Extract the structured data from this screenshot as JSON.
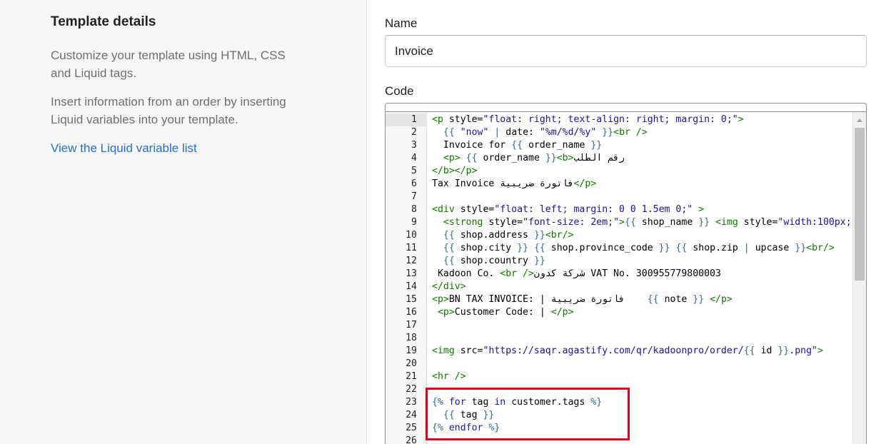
{
  "sidebar": {
    "title": "Template details",
    "description1": "Customize your template using HTML, CSS and Liquid tags.",
    "description2": "Insert information from an order by inserting Liquid variables into your template.",
    "link": "View the Liquid variable list"
  },
  "form": {
    "name_label": "Name",
    "name_value": "Invoice",
    "code_label": "Code"
  },
  "editor": {
    "lines": [
      {
        "n": "1",
        "segs": [
          [
            "t",
            "<p "
          ],
          [
            "a",
            "style="
          ],
          [
            "s",
            "\"float: right; text-align: right; margin: 0;\""
          ],
          [
            "t",
            ">"
          ]
        ]
      },
      {
        "n": "2",
        "segs": [
          [
            "p",
            "  "
          ],
          [
            "lq",
            "{{ "
          ],
          [
            "s",
            "\"now\""
          ],
          [
            "lq",
            " | "
          ],
          [
            "p",
            "date: "
          ],
          [
            "s",
            "\"%m/%d/%y\""
          ],
          [
            "lq",
            " }}"
          ],
          [
            "t",
            "<br />"
          ]
        ]
      },
      {
        "n": "3",
        "segs": [
          [
            "p",
            "  Invoice for "
          ],
          [
            "lq",
            "{{ "
          ],
          [
            "p",
            "order_name"
          ],
          [
            "lq",
            " }}"
          ]
        ]
      },
      {
        "n": "4",
        "segs": [
          [
            "p",
            "  "
          ],
          [
            "t",
            "<p>"
          ],
          [
            "p",
            " "
          ],
          [
            "lq",
            "{{ "
          ],
          [
            "p",
            "order_name"
          ],
          [
            "lq",
            " }}"
          ],
          [
            "t",
            "<b>"
          ],
          [
            "p",
            "رقم الطلب"
          ]
        ]
      },
      {
        "n": "5",
        "segs": [
          [
            "t",
            "</b></p>"
          ]
        ]
      },
      {
        "n": "6",
        "segs": [
          [
            "p",
            "Tax Invoice فاتورة ضريبية"
          ],
          [
            "t",
            "</p>"
          ]
        ]
      },
      {
        "n": "7",
        "segs": []
      },
      {
        "n": "8",
        "segs": [
          [
            "t",
            "<div "
          ],
          [
            "a",
            "style="
          ],
          [
            "s",
            "\"float: left; margin: 0 0 1.5em 0;\""
          ],
          [
            "p",
            " "
          ],
          [
            "t",
            ">"
          ]
        ]
      },
      {
        "n": "9",
        "segs": [
          [
            "p",
            "  "
          ],
          [
            "t",
            "<strong "
          ],
          [
            "a",
            "style="
          ],
          [
            "s",
            "\"font-size: 2em;\""
          ],
          [
            "t",
            ">"
          ],
          [
            "lq",
            "{{ "
          ],
          [
            "p",
            "shop_name"
          ],
          [
            "lq",
            " }}"
          ],
          [
            "p",
            " "
          ],
          [
            "t",
            "<img "
          ],
          [
            "a",
            "style="
          ],
          [
            "s",
            "\"width:100px;\""
          ]
        ]
      },
      {
        "n": "10",
        "segs": [
          [
            "p",
            "  "
          ],
          [
            "lq",
            "{{ "
          ],
          [
            "p",
            "shop.address"
          ],
          [
            "lq",
            " }}"
          ],
          [
            "t",
            "<br/>"
          ]
        ]
      },
      {
        "n": "11",
        "segs": [
          [
            "p",
            "  "
          ],
          [
            "lq",
            "{{ "
          ],
          [
            "p",
            "shop.city"
          ],
          [
            "lq",
            " }}"
          ],
          [
            "p",
            " "
          ],
          [
            "lq",
            "{{ "
          ],
          [
            "p",
            "shop.province_code"
          ],
          [
            "lq",
            " }}"
          ],
          [
            "p",
            " "
          ],
          [
            "lq",
            "{{ "
          ],
          [
            "p",
            "shop.zip"
          ],
          [
            "lq",
            " | "
          ],
          [
            "p",
            "upcase"
          ],
          [
            "lq",
            " }}"
          ],
          [
            "t",
            "<br/>"
          ]
        ]
      },
      {
        "n": "12",
        "segs": [
          [
            "p",
            "  "
          ],
          [
            "lq",
            "{{ "
          ],
          [
            "p",
            "shop.country"
          ],
          [
            "lq",
            " }}"
          ]
        ]
      },
      {
        "n": "13",
        "segs": [
          [
            "p",
            " Kadoon Co. "
          ],
          [
            "t",
            "<br />"
          ],
          [
            "p",
            "شركة كدون VAT No. 300955779800003"
          ]
        ]
      },
      {
        "n": "14",
        "segs": [
          [
            "t",
            "</div>"
          ]
        ]
      },
      {
        "n": "15",
        "segs": [
          [
            "t",
            "<p>"
          ],
          [
            "p",
            "BN TAX INVOICE: | فاتورة ضريبية    "
          ],
          [
            "lq",
            "{{ "
          ],
          [
            "p",
            "note"
          ],
          [
            "lq",
            " }}"
          ],
          [
            "p",
            " "
          ],
          [
            "t",
            "</p>"
          ]
        ]
      },
      {
        "n": "16",
        "segs": [
          [
            "p",
            " "
          ],
          [
            "t",
            "<p>"
          ],
          [
            "p",
            "Customer Code: | "
          ],
          [
            "t",
            "</p>"
          ]
        ]
      },
      {
        "n": "17",
        "segs": []
      },
      {
        "n": "18",
        "segs": []
      },
      {
        "n": "19",
        "segs": [
          [
            "t",
            "<img "
          ],
          [
            "a",
            "src="
          ],
          [
            "s",
            "\"https://saqr.agastify.com/qr/kadoonpro/order/"
          ],
          [
            "lq",
            "{{ "
          ],
          [
            "p",
            "id"
          ],
          [
            "lq",
            " }}"
          ],
          [
            "s",
            ".png\""
          ],
          [
            "t",
            ">"
          ]
        ]
      },
      {
        "n": "20",
        "segs": []
      },
      {
        "n": "21",
        "segs": [
          [
            "t",
            "<hr />"
          ]
        ]
      },
      {
        "n": "22",
        "segs": []
      },
      {
        "n": "23",
        "segs": [
          [
            "lq",
            "{% "
          ],
          [
            "kw",
            "for"
          ],
          [
            "p",
            " tag "
          ],
          [
            "kw",
            "in"
          ],
          [
            "p",
            " customer.tags "
          ],
          [
            "lq",
            "%}"
          ]
        ]
      },
      {
        "n": "24",
        "segs": [
          [
            "p",
            "  "
          ],
          [
            "lq",
            "{{ "
          ],
          [
            "p",
            "tag"
          ],
          [
            "lq",
            " }}"
          ]
        ]
      },
      {
        "n": "25",
        "segs": [
          [
            "lq",
            "{% "
          ],
          [
            "kw",
            "endfor"
          ],
          [
            "p",
            " "
          ],
          [
            "lq",
            "%}"
          ]
        ]
      },
      {
        "n": "26",
        "segs": []
      }
    ]
  },
  "colors": {
    "tag": "#117700",
    "string": "#221199",
    "liquid_delim": "#3a6a8a",
    "keyword": "#1a1aa6",
    "highlight_box": "#e3001b",
    "link": "#2c6ecb"
  }
}
